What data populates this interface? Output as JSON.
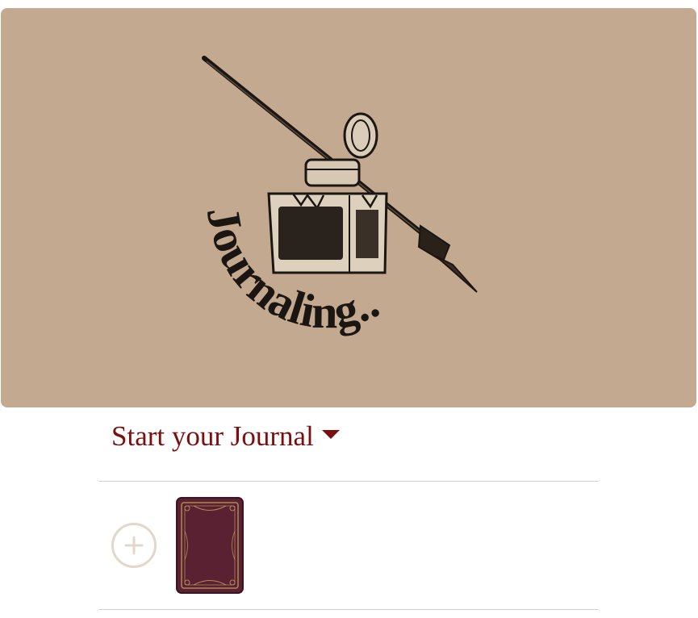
{
  "hero": {
    "logo_text": "Journaling..",
    "background_color": "#c2a990",
    "logo_icon": "inkwell-quill-pen-icon"
  },
  "journal_menu": {
    "label": "Start your Journal",
    "caret_icon": "caret-down-icon",
    "accent_color": "#7a0f0f"
  },
  "journals": {
    "add_icon": "plus-circle-icon",
    "items": [
      {
        "cover_color": "#5a2132",
        "cover_trim": "#b08b55"
      }
    ]
  }
}
